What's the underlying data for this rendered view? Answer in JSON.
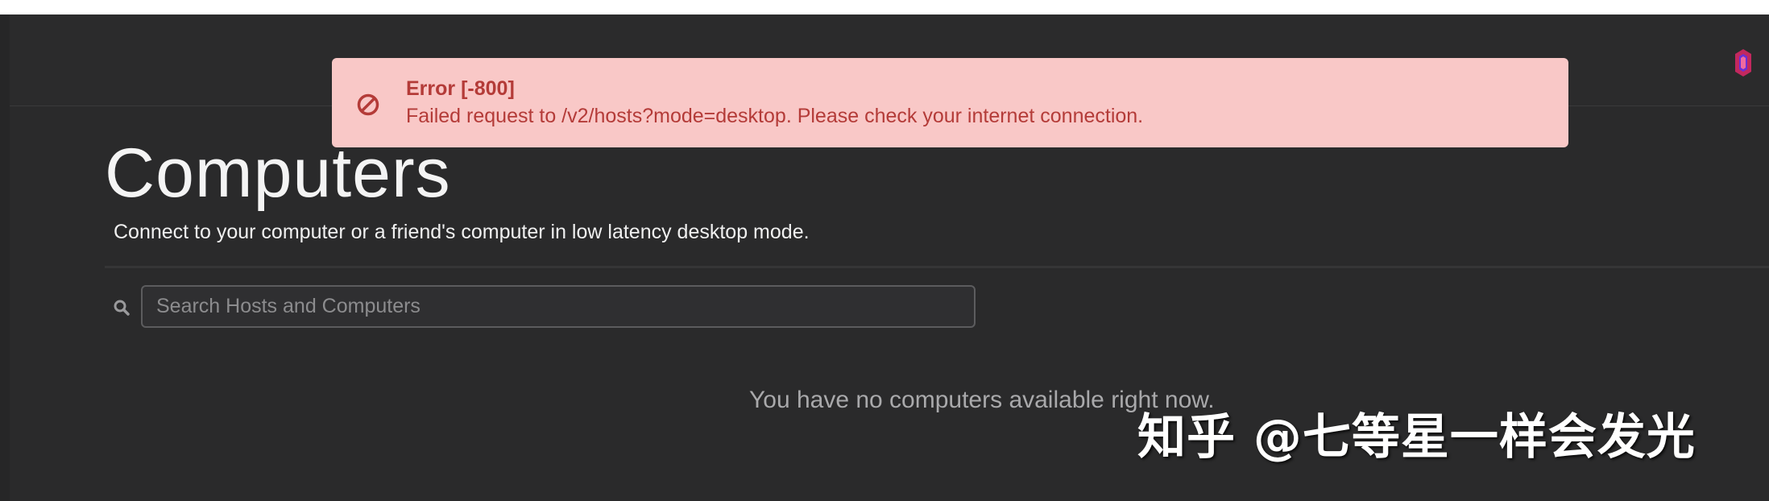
{
  "toast": {
    "title": "Error [-800]",
    "message": "Failed request to /v2/hosts?mode=desktop. Please check your internet connection.",
    "icon": "blocked-icon"
  },
  "page": {
    "title": "Computers",
    "subtitle": "Connect to your computer or a friend's computer in low latency desktop mode."
  },
  "search": {
    "placeholder": "Search Hosts and Computers",
    "value": "",
    "icon": "search-icon"
  },
  "empty_state": {
    "message": "You have no computers available right now."
  },
  "watermark": {
    "text": "知乎 @七等星一样会发光"
  },
  "colors": {
    "background": "#2a2a2b",
    "toast_bg": "#f9c8c7",
    "toast_text": "#b43b38",
    "logo_accent": "#e0306e"
  }
}
